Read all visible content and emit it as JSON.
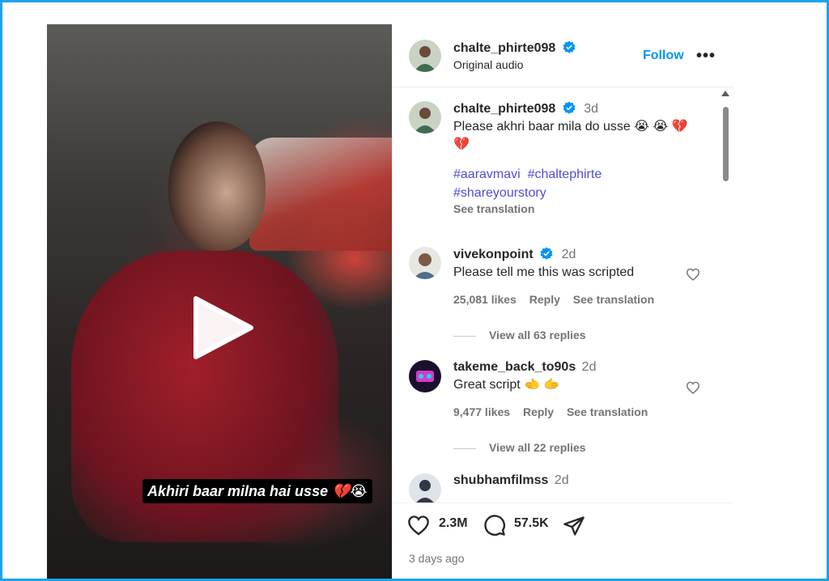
{
  "post": {
    "author": "chalte_phirte098",
    "subtitle": "Original audio",
    "follow_label": "Follow",
    "more_label": "•••"
  },
  "caption": {
    "author": "chalte_phirte098",
    "time": "3d",
    "text": "Please akhri baar mila do usse 😭 😭 💔",
    "text_line2": "💔",
    "hashtags": [
      "#aaravmavi",
      "#chaltephirte",
      "#shareyourstory"
    ],
    "see_translation": "See translation"
  },
  "comments": [
    {
      "author": "vivekonpoint",
      "verified": true,
      "time": "2d",
      "text": "Please tell me this was scripted",
      "likes": "25,081 likes",
      "reply": "Reply",
      "see_translation": "See translation",
      "view_replies": "View all 63 replies"
    },
    {
      "author": "takeme_back_to90s",
      "verified": false,
      "time": "2d",
      "text": "Great script 🫲 🫱",
      "likes": "9,477 likes",
      "reply": "Reply",
      "see_translation": "See translation",
      "view_replies": "View all 22 replies"
    },
    {
      "author": "shubhamfilmss",
      "verified": false,
      "time": "2d",
      "text": ""
    }
  ],
  "actions": {
    "likes": "2.3M",
    "comments": "57.5K",
    "posted": "3 days ago"
  },
  "video": {
    "caption": "Akhiri baar milna hai usse 💔😭"
  },
  "icons": {
    "verified": "verified-badge-icon",
    "heart": "heart-icon",
    "comment": "comment-icon",
    "share": "share-icon",
    "play": "play-icon"
  },
  "colors": {
    "accent": "#0095f6",
    "hashtag": "#4c4fd4",
    "muted": "#737373",
    "frame": "#1fa0ea"
  }
}
